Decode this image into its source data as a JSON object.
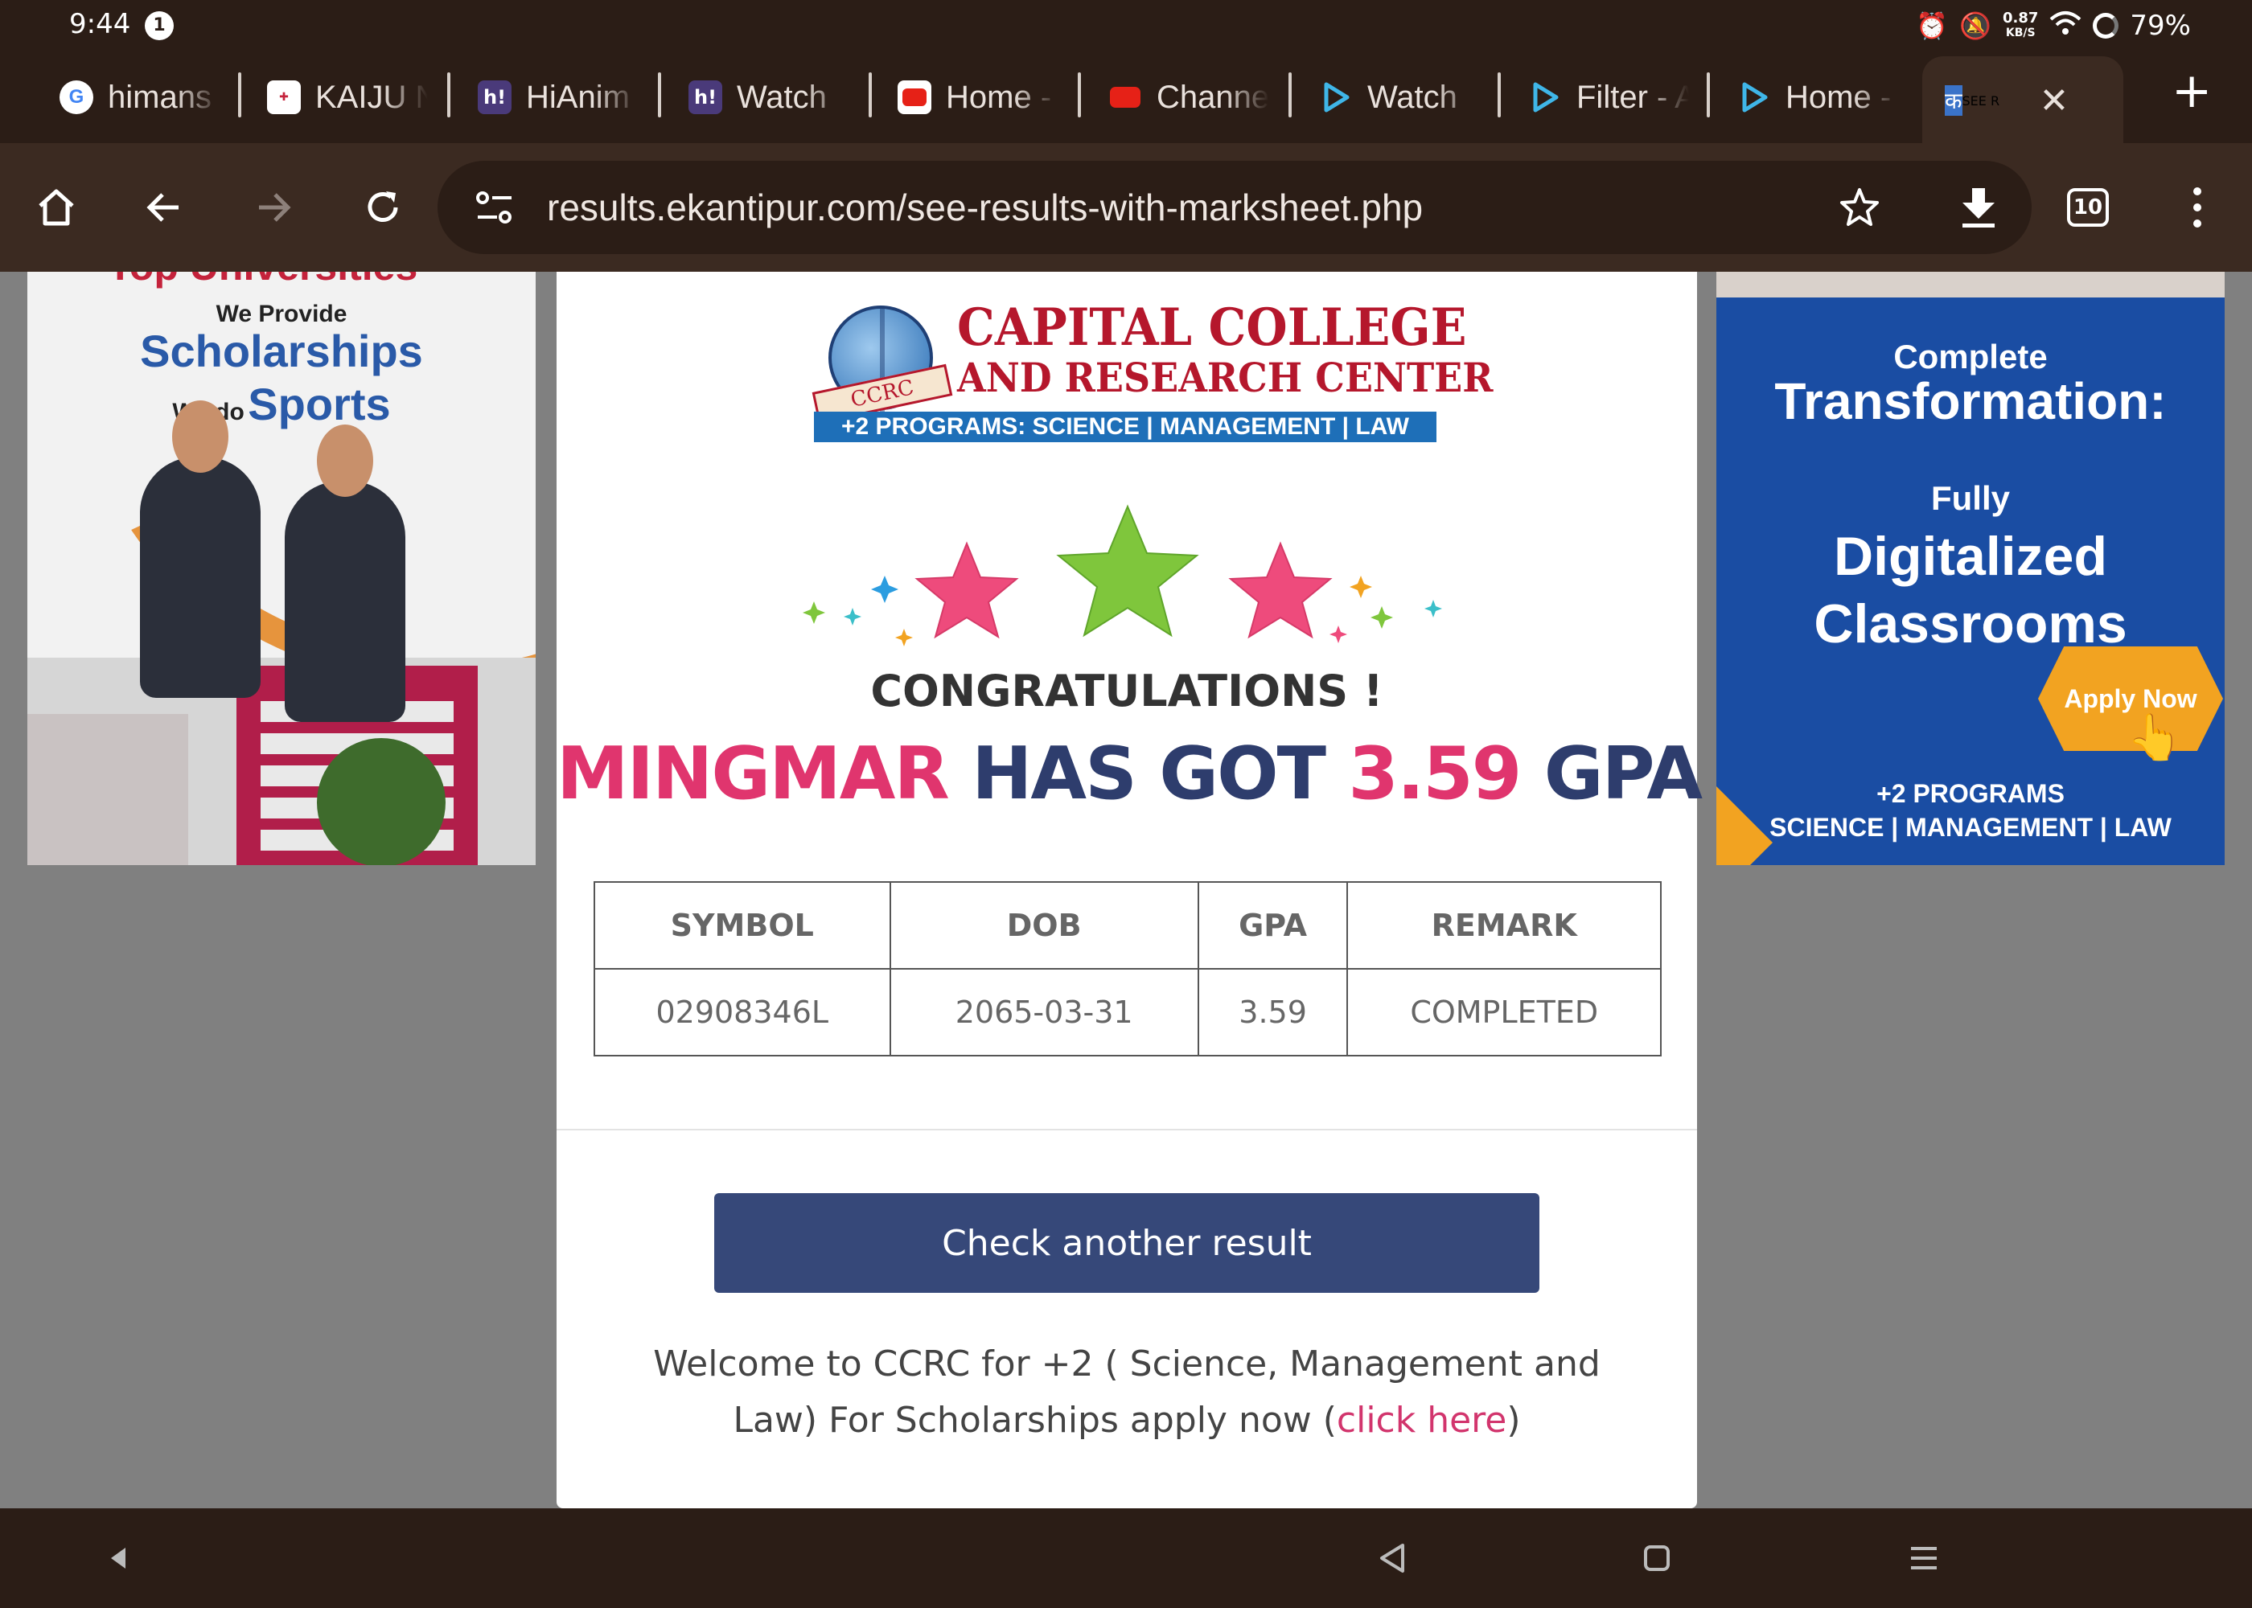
{
  "status_bar": {
    "time": "9:44",
    "notification_count": "1",
    "net_speed_value": "0.87",
    "net_speed_unit": "KB/S",
    "battery": "79%"
  },
  "tabs": [
    {
      "title": "himans",
      "favicon": "google-icon"
    },
    {
      "title": "KAIJU N",
      "favicon": "manga-icon"
    },
    {
      "title": "HiAnim",
      "favicon": "hianime-icon"
    },
    {
      "title": "Watch",
      "favicon": "hianime-icon"
    },
    {
      "title": "Home -",
      "favicon": "youtube-icon"
    },
    {
      "title": "Channe",
      "favicon": "youtube-icon"
    },
    {
      "title": "Watch",
      "favicon": "play-icon"
    },
    {
      "title": "Filter - A",
      "favicon": "play-icon"
    },
    {
      "title": "Home -",
      "favicon": "play-icon"
    },
    {
      "title": "SEE R",
      "favicon": "ekantipur-icon",
      "active": true
    }
  ],
  "toolbar": {
    "url": "results.ekantipur.com/see-results-with-marksheet.php",
    "tab_count": "10"
  },
  "ad_left": {
    "cut_text": "Top Universities",
    "line1": "We Provide",
    "line2": "Scholarships",
    "line3_small": "We do",
    "line3_big": "Sports"
  },
  "ad_right": {
    "t1": "Complete",
    "t2": "Transformation:",
    "t3": "Fully",
    "t4a": "Digitalized",
    "t4b": "Classrooms",
    "apply": "Apply Now",
    "t5a": "+2 PROGRAMS",
    "t5b": "SCIENCE | MANAGEMENT | LAW"
  },
  "logo": {
    "title_line1": "CAPITAL COLLEGE",
    "title_line2": "AND RESEARCH CENTER",
    "ribbon": "CCRC",
    "programs_bar": "+2 PROGRAMS: SCIENCE | MANAGEMENT | LAW",
    "colors": {
      "red": "#b5172c",
      "blue": "#1e6fb8"
    }
  },
  "result": {
    "congrats": "CONGRATULATIONS !",
    "name": "MINGMAR",
    "has_got": "HAS GOT",
    "gpa_value": "3.59",
    "gpa_label": "GPA",
    "table": {
      "headers": [
        "SYMBOL",
        "DOB",
        "GPA",
        "REMARK"
      ],
      "row": [
        "02908346L",
        "2065-03-31",
        "3.59",
        "COMPLETED"
      ]
    },
    "check_button": "Check another result",
    "welcome_text": "Welcome to CCRC for +2 ( Science, Management and Law) For Scholarships apply now (",
    "click_here": "click here",
    "welcome_close": ")"
  },
  "theme": {
    "pink": "#e0356e",
    "navy": "#2e3d6d",
    "button": "#364879",
    "star_pink": "#ee4b7c",
    "star_green": "#7fc63c"
  }
}
